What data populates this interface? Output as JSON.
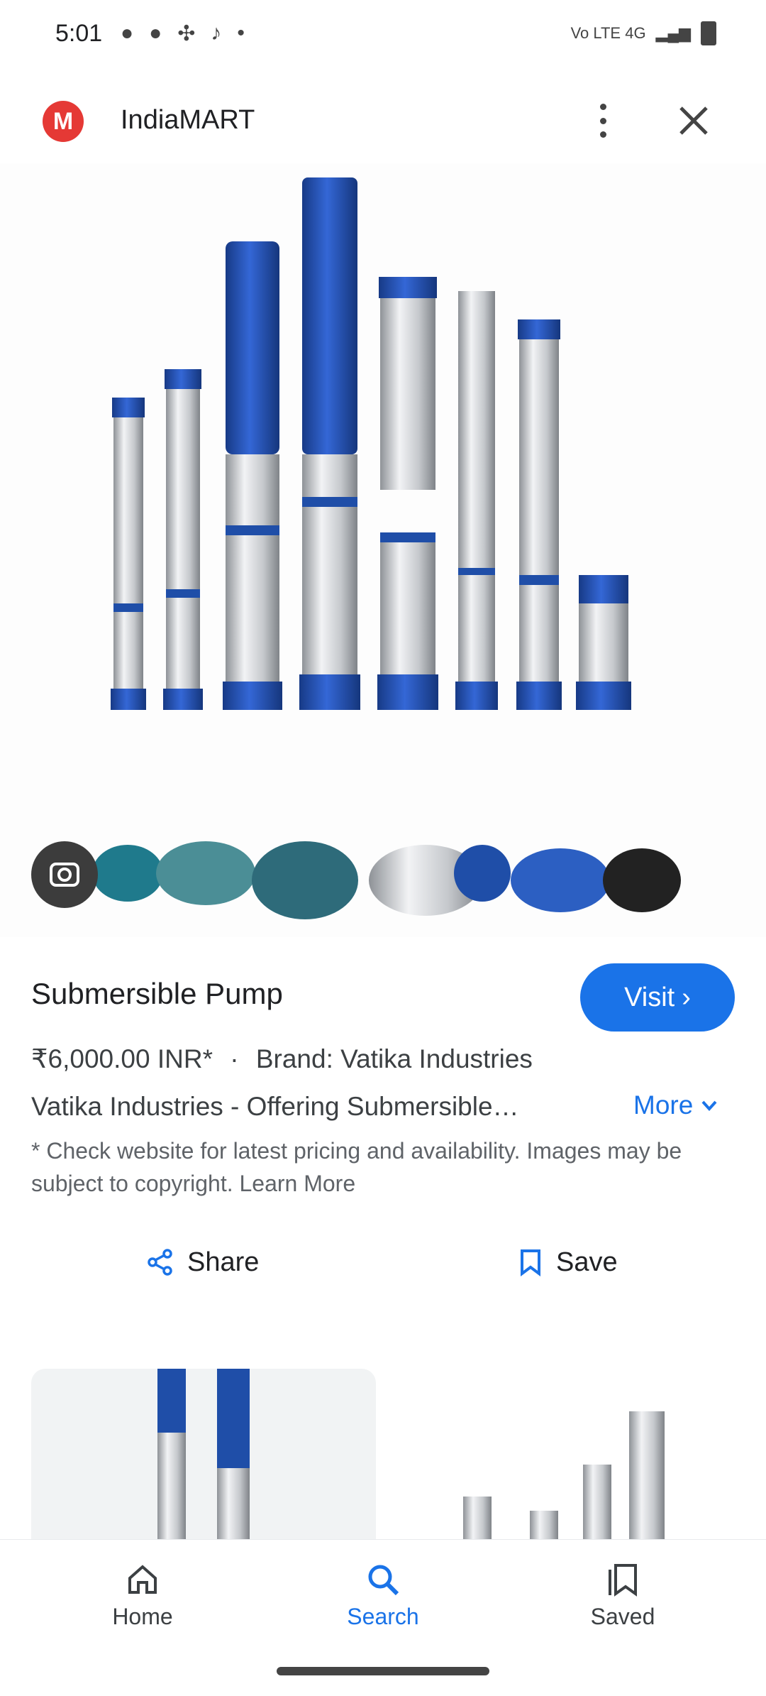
{
  "status_bar": {
    "time": "5:01",
    "network": "Vo LTE 4G"
  },
  "header": {
    "site_name": "IndiaMART",
    "logo_letter": "M"
  },
  "product": {
    "title": "Submersible Pump",
    "visit_label": "Visit",
    "price": "₹6,000.00 INR*",
    "separator": "·",
    "brand": "Brand: Vatika Industries",
    "description": "Vatika Industries - Offering Submersible…",
    "more_label": "More",
    "disclaimer": "* Check website for latest pricing and availability. Images may be subject to copyright. Learn More"
  },
  "actions": {
    "share_label": "Share",
    "save_label": "Save"
  },
  "bottom_nav": [
    {
      "label": "Home"
    },
    {
      "label": "Search"
    },
    {
      "label": "Saved"
    }
  ],
  "colors": {
    "accent": "#1a73e8",
    "pump_blue": "#1f4ea8",
    "steel": "#c8cbd0"
  }
}
